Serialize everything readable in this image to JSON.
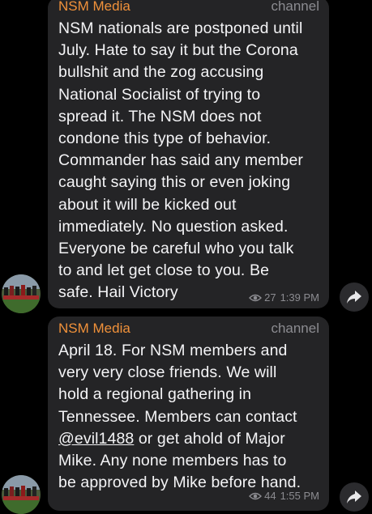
{
  "colors": {
    "background": "#000000",
    "bubble": "#242426",
    "sender": "#f0913a",
    "meta": "#8c8c91",
    "text": "#f4f4f6"
  },
  "messages": [
    {
      "sender": "NSM Media",
      "kind": "channel",
      "lines": [
        "NSM nationals are postponed until",
        "July. Hate to say it but the Corona",
        "bullshit and the zog accusing",
        "National Socialist of trying to",
        "spread it. The NSM does not",
        "condone this type of behavior.",
        "Commander has said any member",
        "caught saying this or even joking",
        "about it will be kicked out",
        "immediately. No question asked.",
        "Everyone be careful who you talk",
        "to and let get close to you. Be",
        "safe. Hail Victory"
      ],
      "views": "27",
      "time": "1:39 PM",
      "avatar_icon": "group-photo-avatar-icon",
      "share_icon": "share-arrow-icon"
    },
    {
      "sender": "NSM Media",
      "kind": "channel",
      "line_1": "April 18. For NSM members and",
      "line_2": "very very close friends. We will",
      "line_3": "hold a regional gathering in",
      "line_4": "Tennessee. Members can contact",
      "mention": "@evil1488",
      "line_5_after": " or get ahold of Major",
      "line_6": "Mike. Any none members has to",
      "line_7": "be approved by Mike before hand.",
      "views": "44",
      "time": "1:55 PM",
      "avatar_icon": "group-photo-avatar-icon",
      "share_icon": "share-arrow-icon"
    }
  ]
}
